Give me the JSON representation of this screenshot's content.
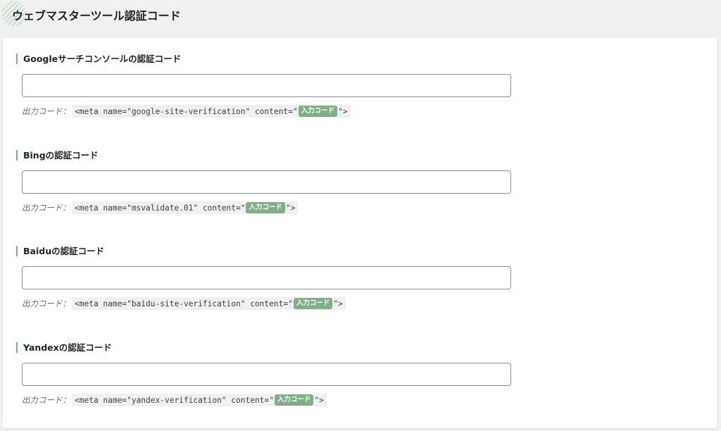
{
  "page": {
    "title": "ウェブマスターツール認証コード"
  },
  "sections": [
    {
      "title": "Googleサーチコンソールの認証コード",
      "input_value": "",
      "output_label": "出力コード：",
      "code_prefix": "<meta name=\"google-site-verification\" content=\"",
      "badge": "入力コード",
      "code_suffix": "\">"
    },
    {
      "title": "Bingの認証コード",
      "input_value": "",
      "output_label": "出力コード：",
      "code_prefix": "<meta name=\"msvalidate.01\" content=\"",
      "badge": "入力コード",
      "code_suffix": "\">"
    },
    {
      "title": "Baiduの認証コード",
      "input_value": "",
      "output_label": "出力コード：",
      "code_prefix": "<meta name=\"baidu-site-verification\" content=\"",
      "badge": "入力コード",
      "code_suffix": "\">"
    },
    {
      "title": "Yandexの認証コード",
      "input_value": "",
      "output_label": "出力コード：",
      "code_prefix": "<meta name=\"yandex-verification\" content=\"",
      "badge": "入力コード",
      "code_suffix": "\">"
    }
  ],
  "colors": {
    "accent": "#7fae87",
    "background": "#f0f0f0",
    "panel": "#ffffff",
    "code_background": "#f0f0f1"
  }
}
